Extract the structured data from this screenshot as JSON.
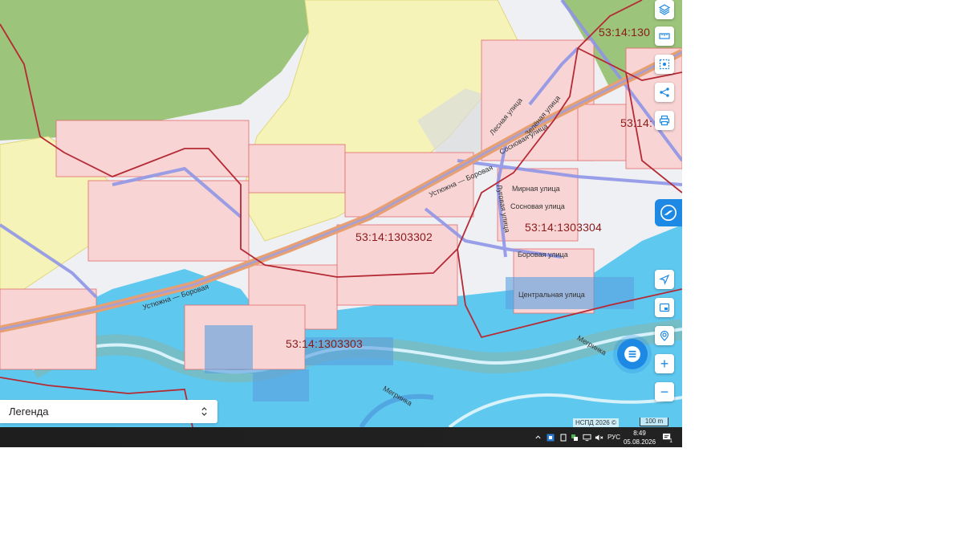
{
  "map": {
    "cadastral_labels": [
      {
        "id": "a",
        "text": "53:14:130"
      },
      {
        "id": "b",
        "text": "53:14:"
      },
      {
        "id": "c",
        "text": "53:14:1303302"
      },
      {
        "id": "d",
        "text": "53:14:1303304"
      },
      {
        "id": "e",
        "text": "53:14:1303303"
      }
    ],
    "streets": [
      {
        "id": "s1",
        "text": "Устюжна — Боровая"
      },
      {
        "id": "s2",
        "text": "Устюжна — Боровая"
      },
      {
        "id": "s3",
        "text": "Лесная улица"
      },
      {
        "id": "s4",
        "text": "Зелёная улица"
      },
      {
        "id": "s5",
        "text": "Сосновая улица"
      },
      {
        "id": "s6",
        "text": "Мирная улица"
      },
      {
        "id": "s7",
        "text": "Сосновая улица"
      },
      {
        "id": "s8",
        "text": "Луговая улица"
      },
      {
        "id": "s9",
        "text": "Боровая улица"
      },
      {
        "id": "s10",
        "text": "Центральная улица"
      },
      {
        "id": "s11",
        "text": "Мегринка"
      },
      {
        "id": "s12",
        "text": "Мегринка"
      }
    ],
    "attribution": "НСПД 2026 ©",
    "scale_label": "100 m",
    "colors": {
      "forest": "#9cc47a",
      "field": "#f6f3b8",
      "water": "#5fc8ef",
      "parcel": "#e46a6a",
      "road": "#e8a070",
      "boundary": "#b52a34"
    }
  },
  "toolbar": {
    "icons": [
      "layers-icon",
      "ruler-icon",
      "select-area-icon",
      "share-icon",
      "print-icon"
    ]
  },
  "controls": {
    "icons": [
      "navigate-icon",
      "minimap-icon",
      "location-icon",
      "zoom-in-icon",
      "zoom-out-icon"
    ],
    "zoom_in": "+",
    "zoom_out": "−"
  },
  "legend": {
    "label": "Легенда"
  },
  "taskbar": {
    "lang": "РУС",
    "time": "8:49",
    "date": "05.08.2026",
    "notifications": "1"
  }
}
